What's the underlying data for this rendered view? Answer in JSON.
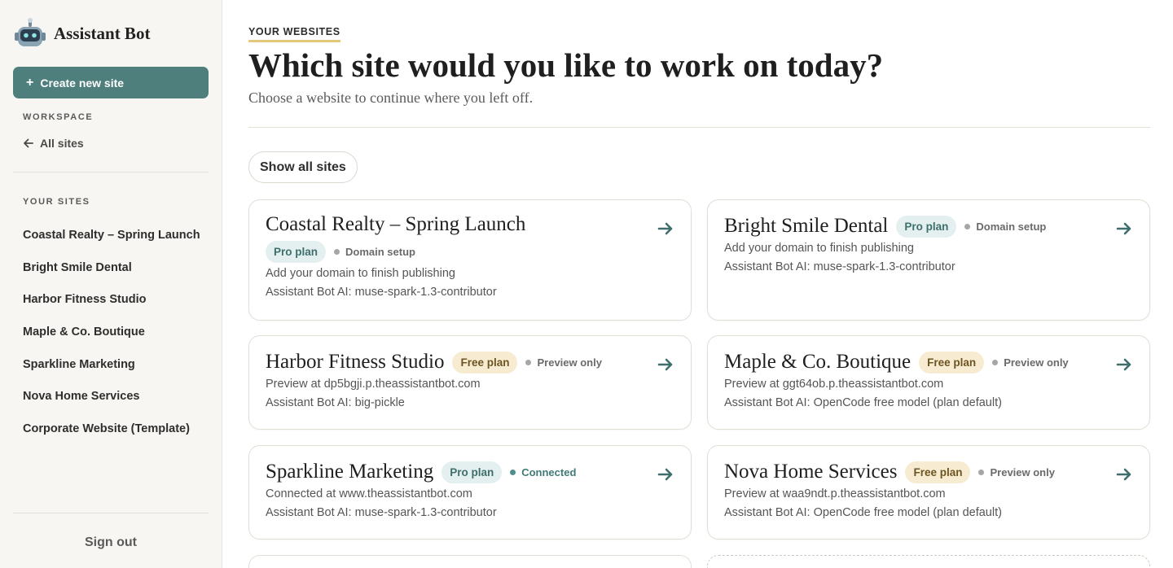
{
  "app": {
    "name": "Assistant Bot"
  },
  "sidebar": {
    "create_label": "Create new site",
    "workspace_label": "WORKSPACE",
    "all_sites_label": "All sites",
    "your_sites_label": "YOUR SITES",
    "sites": [
      "Coastal Realty – Spring Launch",
      "Bright Smile Dental",
      "Harbor Fitness Studio",
      "Maple & Co. Boutique",
      "Sparkline Marketing",
      "Nova Home Services",
      "Corporate Website (Template)"
    ],
    "sign_out_label": "Sign out"
  },
  "main": {
    "eyebrow": "YOUR WEBSITES",
    "title": "Which site would you like to work on today?",
    "subtitle": "Choose a website to continue where you left off.",
    "show_all_label": "Show all sites",
    "cards": [
      {
        "name": "Coastal Realty – Spring Launch",
        "plan": "Pro plan",
        "plan_type": "pro",
        "status": "Domain setup",
        "status_type": "neutral",
        "line1": "Add your domain to finish publishing",
        "line2": "Assistant Bot AI: muse-spark-1.3-contributor"
      },
      {
        "name": "Bright Smile Dental",
        "plan": "Pro plan",
        "plan_type": "pro",
        "status": "Domain setup",
        "status_type": "neutral",
        "line1": "Add your domain to finish publishing",
        "line2": "Assistant Bot AI: muse-spark-1.3-contributor"
      },
      {
        "name": "Harbor Fitness Studio",
        "plan": "Free plan",
        "plan_type": "free",
        "status": "Preview only",
        "status_type": "neutral",
        "line1": "Preview at dp5bgji.p.theassistantbot.com",
        "line2": "Assistant Bot AI: big-pickle"
      },
      {
        "name": "Maple & Co. Boutique",
        "plan": "Free plan",
        "plan_type": "free",
        "status": "Preview only",
        "status_type": "neutral",
        "line1": "Preview at ggt64ob.p.theassistantbot.com",
        "line2": "Assistant Bot AI: OpenCode free model (plan default)"
      },
      {
        "name": "Sparkline Marketing",
        "plan": "Pro plan",
        "plan_type": "pro",
        "status": "Connected",
        "status_type": "connected",
        "line1": "Connected at www.theassistantbot.com",
        "line2": "Assistant Bot AI: muse-spark-1.3-contributor"
      },
      {
        "name": "Nova Home Services",
        "plan": "Free plan",
        "plan_type": "free",
        "status": "Preview only",
        "status_type": "neutral",
        "line1": "Preview at waa9ndt.p.theassistantbot.com",
        "line2": "Assistant Bot AI: OpenCode free model (plan default)"
      }
    ]
  },
  "colors": {
    "accent": "#4f7f7c",
    "eyebrow_underline": "#e7c77a",
    "pro_badge_bg": "#e3f0ef",
    "free_badge_bg": "#f7ecd2"
  },
  "icons": {
    "logo": "robot-icon",
    "back": "arrow-left-icon",
    "open": "arrow-right-icon",
    "create": "plus-icon"
  }
}
